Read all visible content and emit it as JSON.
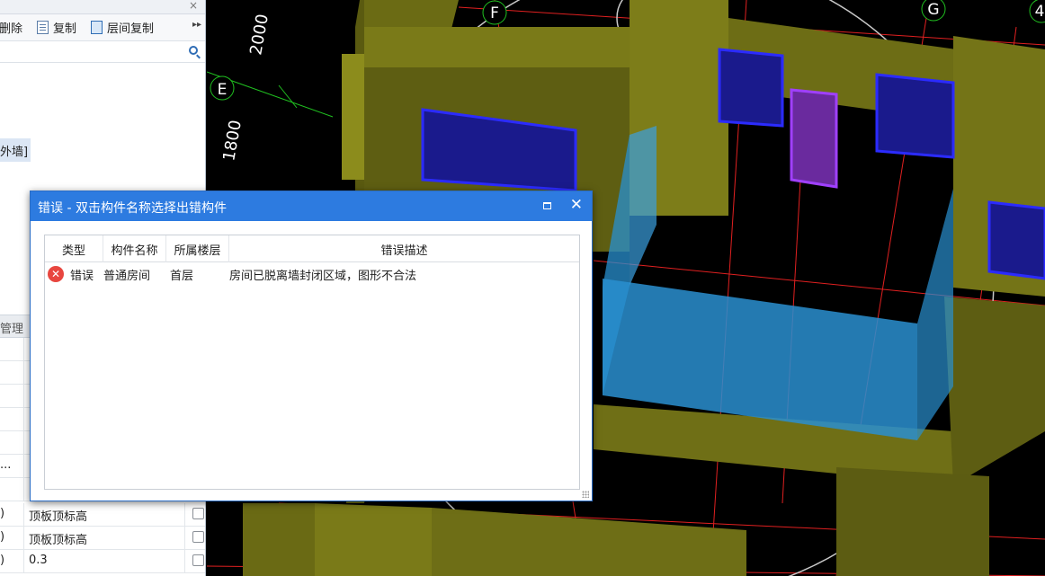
{
  "left_panel": {
    "close_glyph": "×",
    "toolbar": {
      "delete_label": "删除",
      "copy_label": "复制",
      "floor_copy_label": "层间复制",
      "more_glyph": "▸▸"
    },
    "search": {
      "placeholder": ""
    },
    "tree_item_label": "外墙]",
    "props_header": "管理",
    "props_rows": [
      {
        "col_a": "...",
        "col_b": ""
      },
      {
        "col_a": ")",
        "col_b": "顶板顶标高"
      },
      {
        "col_a": ")",
        "col_b": "顶板顶标高"
      },
      {
        "col_a": ")",
        "col_b": "0.3"
      }
    ]
  },
  "viewport": {
    "axis_labels": [
      "F",
      "G",
      "4",
      "E"
    ],
    "dimension_labels": [
      "2000",
      "1800"
    ]
  },
  "error_dialog": {
    "title": "错误 - 双击构件名称选择出错构件",
    "columns": [
      "类型",
      "构件名称",
      "所属楼层",
      "错误描述"
    ],
    "rows": [
      {
        "type": "错误",
        "component": "普通房间",
        "floor": "首层",
        "description": "房间已脱离墙封闭区域，图形不合法"
      }
    ],
    "colors": {
      "titlebar": "#2d7be0",
      "error_icon": "#e8463f"
    }
  }
}
